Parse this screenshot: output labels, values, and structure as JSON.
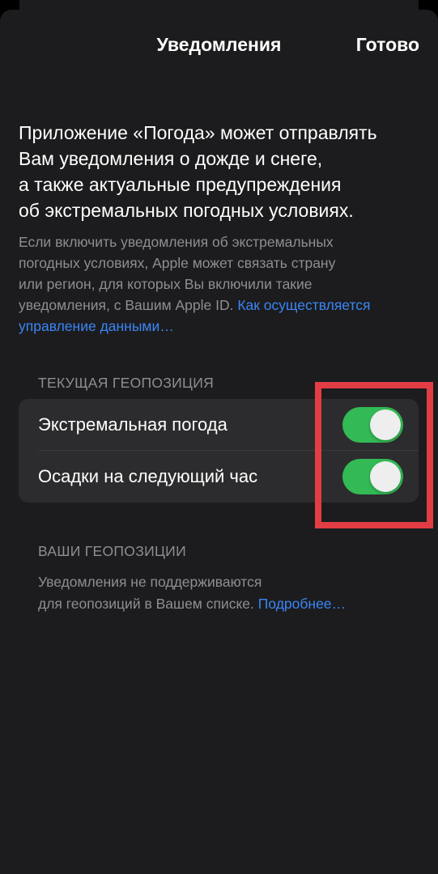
{
  "nav": {
    "title": "Уведомления",
    "done_label": "Готово"
  },
  "intro": {
    "lines": [
      "Приложение «Погода» может отправлять",
      "Вам уведомления о дожде и снеге,",
      "а также актуальные предупреждения",
      "об экстремальных погодных условиях."
    ]
  },
  "privacy": {
    "lines": [
      "Если включить уведомления об экстремальных",
      "погодных условиях, Apple может связать страну",
      "или регион, для которых Вы включили такие"
    ],
    "line4_text": "уведомления, с Вашим Apple ID.",
    "link_part1": "Как осуществляется",
    "link_part2": "управление данными…"
  },
  "current_location": {
    "header": "ТЕКУЩАЯ ГЕОПОЗИЦИЯ",
    "rows": [
      {
        "label": "Экстремальная погода",
        "enabled": true
      },
      {
        "label": "Осадки на следующий час",
        "enabled": true
      }
    ]
  },
  "your_locations": {
    "header": "ВАШИ ГЕОПОЗИЦИИ",
    "line1": "Уведомления не поддерживаются",
    "line2_text": "для геопозиций в Вашем списке.",
    "link": "Подробнее…"
  },
  "colors": {
    "sheet_background": "#1c1c1e",
    "group_background": "#2c2c2e",
    "toggle_on": "#34c759",
    "link": "#3a86f5",
    "secondary_text": "#8e8e93",
    "highlight_box": "#e23d45"
  }
}
